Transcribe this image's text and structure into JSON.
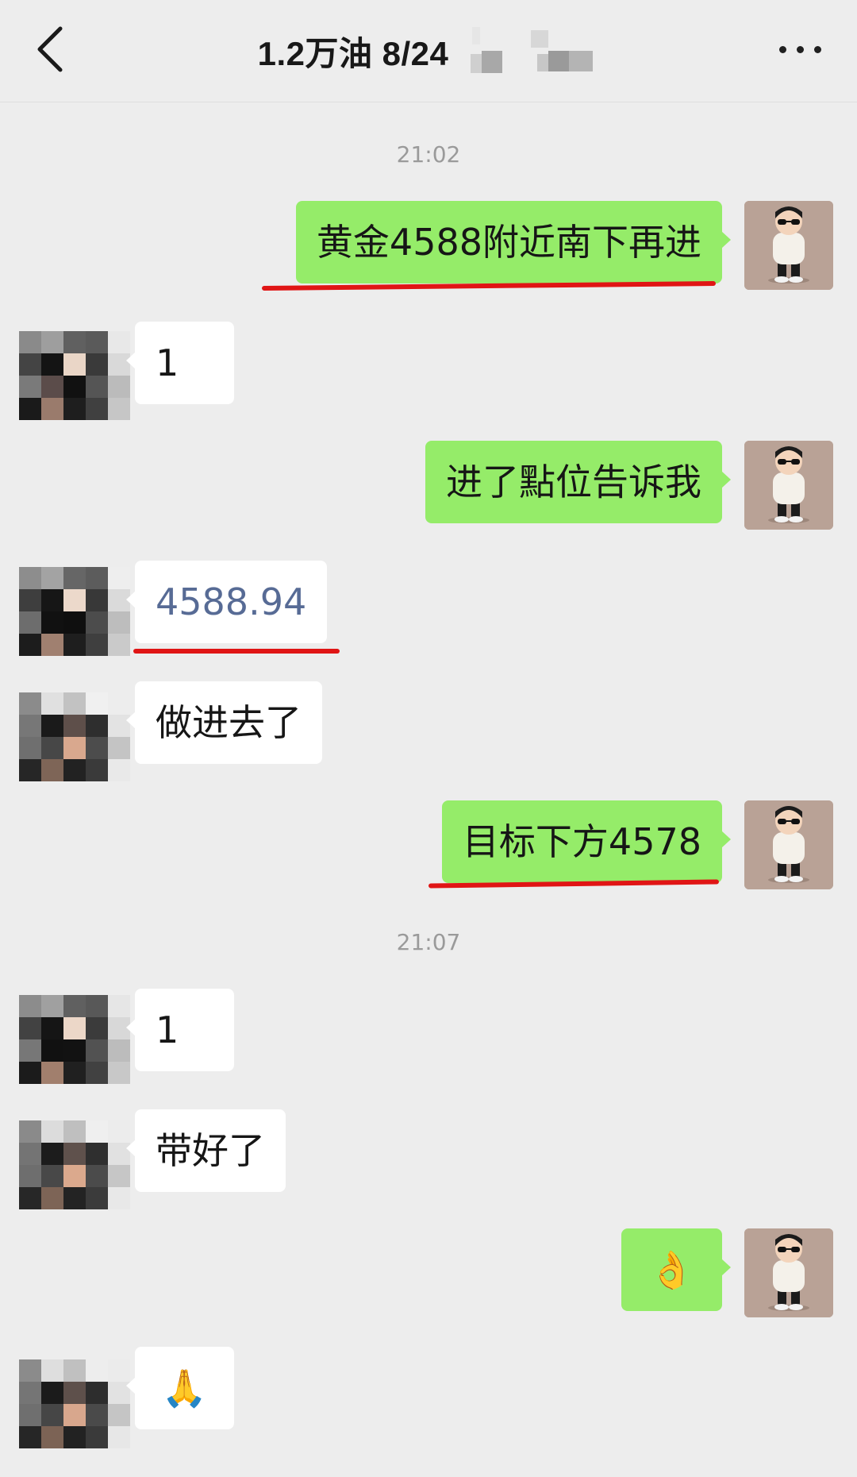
{
  "header": {
    "title": "1.2万油  8/24"
  },
  "messages": [
    {
      "id": "ts1",
      "time": "21:02"
    },
    {
      "id": "m1",
      "side": "sent",
      "text": "黄金4588附近南下再进",
      "underlined": true
    },
    {
      "id": "m2",
      "side": "recv",
      "text": "1"
    },
    {
      "id": "m3",
      "side": "sent",
      "text": "进了點位告诉我"
    },
    {
      "id": "m4",
      "side": "recv",
      "text": "4588.94",
      "underlined": true,
      "link": true
    },
    {
      "id": "m5",
      "side": "recv",
      "text": "做进去了"
    },
    {
      "id": "m6",
      "side": "sent",
      "text": "目标下方4578",
      "underlined": true
    },
    {
      "id": "ts2",
      "time": "21:07"
    },
    {
      "id": "m7",
      "side": "recv",
      "text": "1"
    },
    {
      "id": "m8",
      "side": "recv",
      "text": "带好了"
    },
    {
      "id": "m9",
      "side": "sent",
      "text": "👌"
    },
    {
      "id": "m10",
      "side": "recv",
      "text": "🙏"
    }
  ],
  "colors": {
    "background": "#ededed",
    "sent_bubble": "#95ec69",
    "received_bubble": "#ffffff",
    "underline": "#e01515",
    "link_text": "#576b95"
  },
  "icons": {
    "back": "chevron-left-icon",
    "more": "more-dots-icon"
  }
}
